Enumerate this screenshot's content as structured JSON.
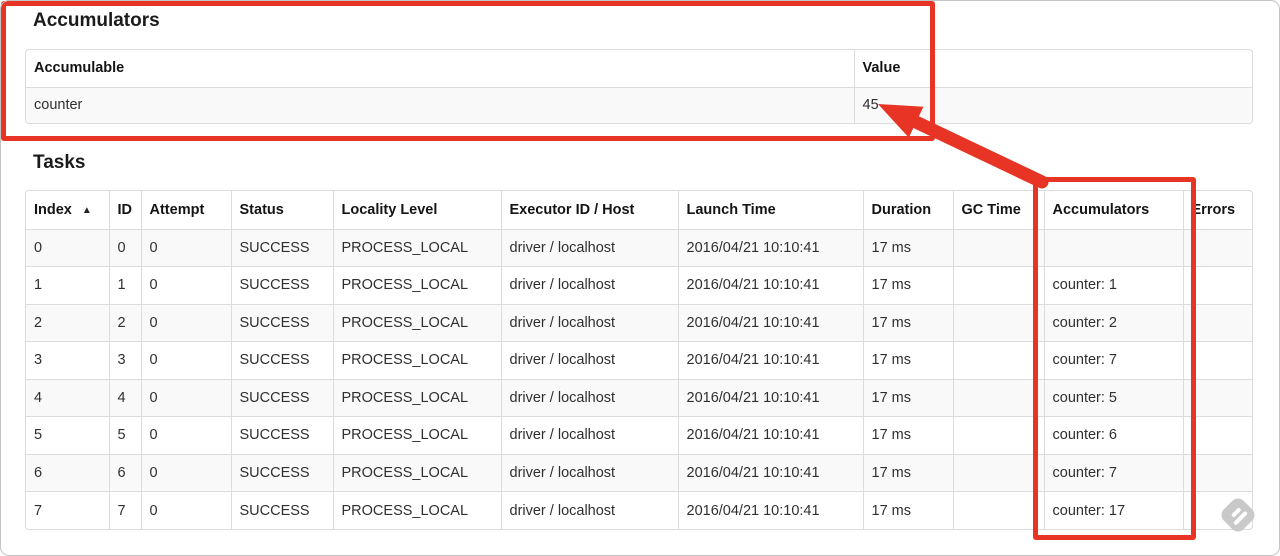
{
  "accumulators_section": {
    "heading": "Accumulators",
    "columns": {
      "accumulable": "Accumulable",
      "value": "Value"
    },
    "rows": [
      {
        "accumulable": "counter",
        "value": "45"
      }
    ]
  },
  "tasks_section": {
    "heading": "Tasks",
    "columns": {
      "index": "Index",
      "id": "ID",
      "attempt": "Attempt",
      "status": "Status",
      "locality": "Locality Level",
      "executor": "Executor ID / Host",
      "launch": "Launch Time",
      "duration": "Duration",
      "gc_time": "GC Time",
      "accumulators": "Accumulators",
      "errors": "Errors"
    },
    "sort": {
      "column": "Index",
      "direction": "ascending",
      "icon": "▲"
    },
    "rows": [
      {
        "index": "0",
        "id": "0",
        "attempt": "0",
        "status": "SUCCESS",
        "locality": "PROCESS_LOCAL",
        "executor": "driver / localhost",
        "launch": "2016/04/21 10:10:41",
        "duration": "17 ms",
        "gc_time": "",
        "accumulators": "",
        "errors": ""
      },
      {
        "index": "1",
        "id": "1",
        "attempt": "0",
        "status": "SUCCESS",
        "locality": "PROCESS_LOCAL",
        "executor": "driver / localhost",
        "launch": "2016/04/21 10:10:41",
        "duration": "17 ms",
        "gc_time": "",
        "accumulators": "counter: 1",
        "errors": ""
      },
      {
        "index": "2",
        "id": "2",
        "attempt": "0",
        "status": "SUCCESS",
        "locality": "PROCESS_LOCAL",
        "executor": "driver / localhost",
        "launch": "2016/04/21 10:10:41",
        "duration": "17 ms",
        "gc_time": "",
        "accumulators": "counter: 2",
        "errors": ""
      },
      {
        "index": "3",
        "id": "3",
        "attempt": "0",
        "status": "SUCCESS",
        "locality": "PROCESS_LOCAL",
        "executor": "driver / localhost",
        "launch": "2016/04/21 10:10:41",
        "duration": "17 ms",
        "gc_time": "",
        "accumulators": "counter: 7",
        "errors": ""
      },
      {
        "index": "4",
        "id": "4",
        "attempt": "0",
        "status": "SUCCESS",
        "locality": "PROCESS_LOCAL",
        "executor": "driver / localhost",
        "launch": "2016/04/21 10:10:41",
        "duration": "17 ms",
        "gc_time": "",
        "accumulators": "counter: 5",
        "errors": ""
      },
      {
        "index": "5",
        "id": "5",
        "attempt": "0",
        "status": "SUCCESS",
        "locality": "PROCESS_LOCAL",
        "executor": "driver / localhost",
        "launch": "2016/04/21 10:10:41",
        "duration": "17 ms",
        "gc_time": "",
        "accumulators": "counter: 6",
        "errors": ""
      },
      {
        "index": "6",
        "id": "6",
        "attempt": "0",
        "status": "SUCCESS",
        "locality": "PROCESS_LOCAL",
        "executor": "driver / localhost",
        "launch": "2016/04/21 10:10:41",
        "duration": "17 ms",
        "gc_time": "",
        "accumulators": "counter: 7",
        "errors": ""
      },
      {
        "index": "7",
        "id": "7",
        "attempt": "0",
        "status": "SUCCESS",
        "locality": "PROCESS_LOCAL",
        "executor": "driver / localhost",
        "launch": "2016/04/21 10:10:41",
        "duration": "17 ms",
        "gc_time": "",
        "accumulators": "counter: 17",
        "errors": ""
      }
    ]
  },
  "annotations": {
    "red_color": "#e73424",
    "stripe_color": "#f9f9f9",
    "table_border_color": "#dcdcdc"
  }
}
